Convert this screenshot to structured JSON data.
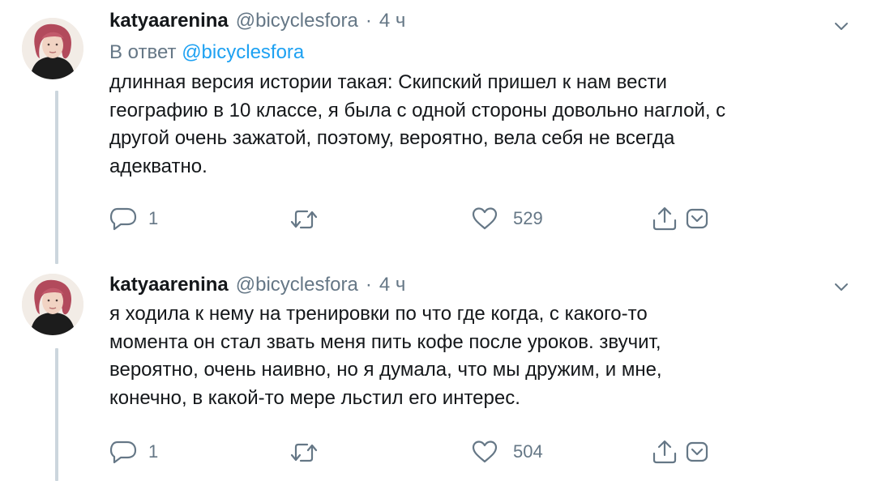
{
  "tweets": [
    {
      "display_name": "katyaarenina",
      "handle": "@bicyclesfora",
      "separator": "·",
      "time": "4 ч",
      "reply_label": "В ответ",
      "reply_to": "@bicyclesfora",
      "text_lines": [
        "длинная версия истории такая: Скипский пришел к нам вести",
        "географию в 10 классе, я была с одной стороны довольно наглой, с",
        "другой очень зажатой, поэтому, вероятно, вела себя не всегда",
        "адекватно."
      ],
      "replies": "1",
      "retweets": "",
      "likes": "529"
    },
    {
      "display_name": "katyaarenina",
      "handle": "@bicyclesfora",
      "separator": "·",
      "time": "4 ч",
      "text_lines": [
        "я ходила к нему на тренировки по что где когда, с какого-то",
        "момента он стал звать меня пить кофе после уроков. звучит,",
        "вероятно, очень наивно, но я думала, что мы дружим, и мне,",
        "конечно, в какой-то мере льстил его интерес."
      ],
      "replies": "1",
      "retweets": "",
      "likes": "504"
    }
  ],
  "icons": {
    "reply": "reply-icon",
    "retweet": "retweet-icon",
    "like": "heart-icon",
    "share": "share-icon",
    "dm": "direct-message-icon",
    "caret": "chevron-down-icon"
  },
  "colors": {
    "text": "#14171a",
    "secondary": "#657786",
    "mention": "#1da1f2",
    "thread_line": "#ccd6dd"
  }
}
